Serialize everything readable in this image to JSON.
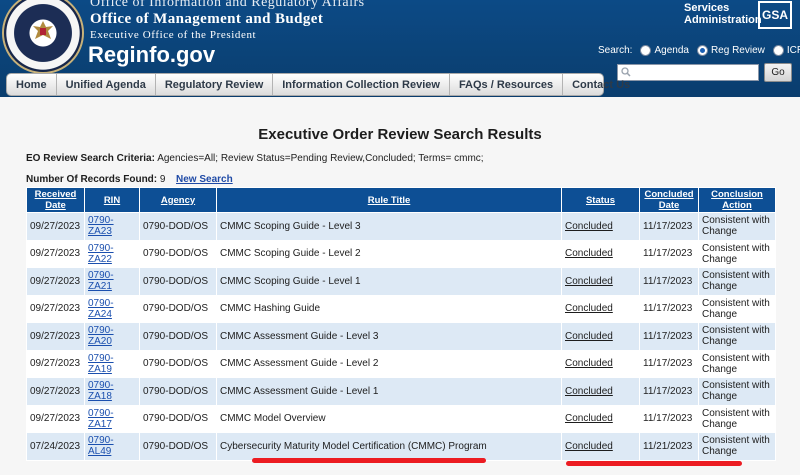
{
  "header": {
    "agency_line": "Office of Information and Regulatory Affairs",
    "omb_line": "Office of Management and Budget",
    "eop_line": "Executive Office of the President",
    "site_name": "Reginfo.gov",
    "gsa_text_1": "Services",
    "gsa_text_2": "Administration",
    "gsa_logo": "GSA",
    "search_label": "Search:",
    "search_options": [
      "Agenda",
      "Reg Review",
      "ICR"
    ],
    "search_selected": "Reg Review",
    "search_placeholder": "",
    "go_label": "Go",
    "seal_colors": {
      "ring": "#16264a",
      "trim": "#c8b27a"
    }
  },
  "nav": {
    "items": [
      "Home",
      "Unified Agenda",
      "Regulatory Review",
      "Information Collection Review",
      "FAQs / Resources",
      "Contact Us"
    ]
  },
  "page": {
    "title": "Executive Order Review Search Results",
    "criteria_label": "EO Review Search Criteria:",
    "criteria_value": "Agencies=All;  Review Status=Pending Review,Concluded;  Terms= cmmc;",
    "records_label": "Number Of Records Found:",
    "records_count": "9",
    "new_search_label": "New Search"
  },
  "table": {
    "headers": [
      "Received Date",
      "RIN",
      "Agency",
      "Rule Title",
      "Status",
      "Concluded Date",
      "Conclusion Action"
    ],
    "rows": [
      {
        "received": "09/27/2023",
        "rin": "0790-ZA23",
        "agency": "0790-DOD/OS",
        "title": "CMMC Scoping Guide - Level 3",
        "status": "Concluded",
        "concluded": "11/17/2023",
        "action": "Consistent with Change"
      },
      {
        "received": "09/27/2023",
        "rin": "0790-ZA22",
        "agency": "0790-DOD/OS",
        "title": "CMMC Scoping Guide - Level 2",
        "status": "Concluded",
        "concluded": "11/17/2023",
        "action": "Consistent with Change"
      },
      {
        "received": "09/27/2023",
        "rin": "0790-ZA21",
        "agency": "0790-DOD/OS",
        "title": "CMMC Scoping Guide - Level 1",
        "status": "Concluded",
        "concluded": "11/17/2023",
        "action": "Consistent with Change"
      },
      {
        "received": "09/27/2023",
        "rin": "0790-ZA24",
        "agency": "0790-DOD/OS",
        "title": "CMMC Hashing Guide",
        "status": "Concluded",
        "concluded": "11/17/2023",
        "action": "Consistent with Change"
      },
      {
        "received": "09/27/2023",
        "rin": "0790-ZA20",
        "agency": "0790-DOD/OS",
        "title": "CMMC Assessment Guide - Level 3",
        "status": "Concluded",
        "concluded": "11/17/2023",
        "action": "Consistent with Change"
      },
      {
        "received": "09/27/2023",
        "rin": "0790-ZA19",
        "agency": "0790-DOD/OS",
        "title": "CMMC Assessment Guide - Level 2",
        "status": "Concluded",
        "concluded": "11/17/2023",
        "action": "Consistent with Change"
      },
      {
        "received": "09/27/2023",
        "rin": "0790-ZA18",
        "agency": "0790-DOD/OS",
        "title": "CMMC Assessment Guide - Level 1",
        "status": "Concluded",
        "concluded": "11/17/2023",
        "action": "Consistent with Change"
      },
      {
        "received": "09/27/2023",
        "rin": "0790-ZA17",
        "agency": "0790-DOD/OS",
        "title": "CMMC Model Overview",
        "status": "Concluded",
        "concluded": "11/17/2023",
        "action": "Consistent with Change"
      },
      {
        "received": "07/24/2023",
        "rin": "0790-AL49",
        "agency": "0790-DOD/OS",
        "title": "Cybersecurity Maturity Model Certification (CMMC) Program",
        "status": "Concluded",
        "concluded": "11/21/2023",
        "action": "Consistent with Change"
      }
    ]
  },
  "colors": {
    "header_blue": "#0b4378",
    "table_header": "#0d4f95",
    "row_stripe": "#dde9f5",
    "link": "#1a4fae",
    "annotation_red": "#ec1c22"
  }
}
